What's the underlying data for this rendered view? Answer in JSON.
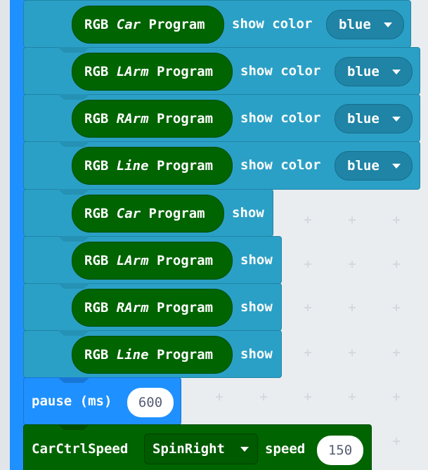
{
  "blocks": [
    {
      "prefix": "RGB ",
      "target": "Car",
      "suffix": " Program",
      "action": "show color",
      "color": "blue"
    },
    {
      "prefix": "RGB ",
      "target": "LArm",
      "suffix": " Program",
      "action": "show color",
      "color": "blue"
    },
    {
      "prefix": "RGB ",
      "target": "RArm",
      "suffix": " Program",
      "action": "show color",
      "color": "blue"
    },
    {
      "prefix": "RGB ",
      "target": "Line",
      "suffix": " Program",
      "action": "show color",
      "color": "blue"
    },
    {
      "prefix": "RGB ",
      "target": "Car",
      "suffix": " Program",
      "action": "show"
    },
    {
      "prefix": "RGB ",
      "target": "LArm",
      "suffix": " Program",
      "action": "show"
    },
    {
      "prefix": "RGB ",
      "target": "RArm",
      "suffix": " Program",
      "action": "show"
    },
    {
      "prefix": "RGB ",
      "target": "Line",
      "suffix": " Program",
      "action": "show"
    }
  ],
  "pause": {
    "label": "pause (ms)",
    "value": "600"
  },
  "car_ctrl": {
    "label": "CarCtrlSpeed",
    "direction": "SpinRight",
    "speed_label": "speed",
    "speed_value": "150"
  },
  "colors": {
    "workspace": "#eaedf0",
    "spine": "#1e90ff",
    "rgb_block": "#2ba0c6",
    "rgb_pill": "#006400",
    "dropdown": "#1f84a6",
    "pause_block": "#1e90ff",
    "car_block": "#006400"
  },
  "icons": {
    "dropdown_caret": "caret-down-icon"
  }
}
